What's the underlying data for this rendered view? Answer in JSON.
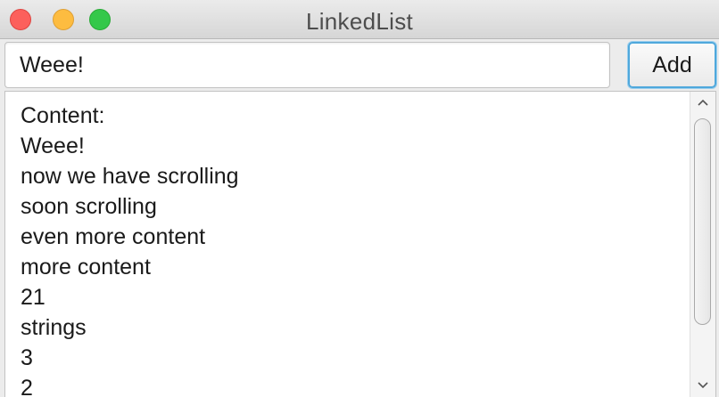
{
  "window": {
    "title": "LinkedList"
  },
  "entry": {
    "value": "Weee!"
  },
  "toolbar": {
    "add_label": "Add"
  },
  "list": {
    "items": [
      "Content:",
      "Weee!",
      "now we have scrolling",
      "soon scrolling",
      "even more content",
      "more content",
      "21",
      "strings",
      "3",
      "2"
    ]
  },
  "scrollbar": {
    "position": 0.0
  },
  "colors": {
    "close": "#fc605c",
    "minimize": "#fdbc40",
    "zoom": "#34c84a",
    "focus": "#4fa8dc"
  }
}
